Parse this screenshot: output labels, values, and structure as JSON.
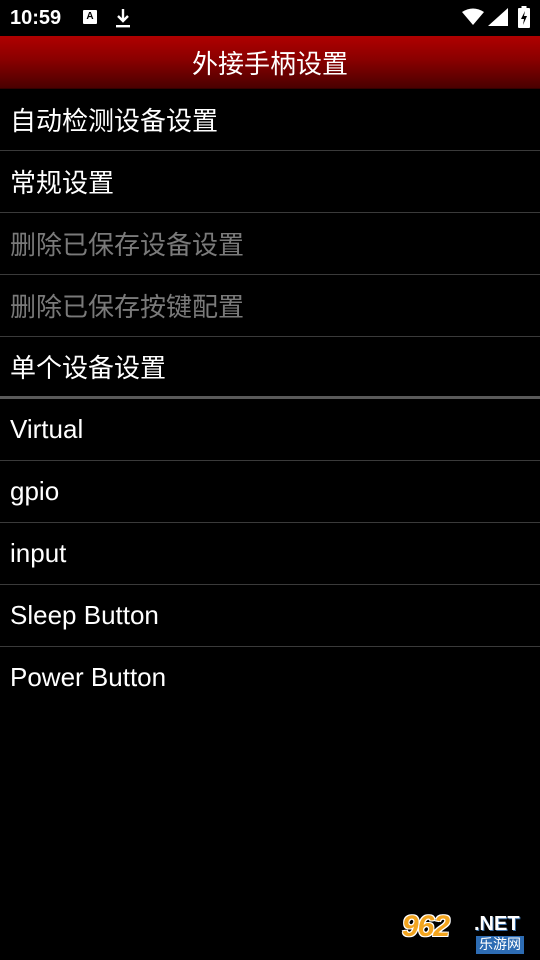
{
  "status_bar": {
    "time": "10:59",
    "notification_a": "A"
  },
  "header": {
    "title": "外接手柄设置"
  },
  "menu": {
    "items": [
      {
        "label": "自动检测设备设置",
        "enabled": true
      },
      {
        "label": "常规设置",
        "enabled": true
      },
      {
        "label": "删除已保存设备设置",
        "enabled": false
      },
      {
        "label": "删除已保存按键配置",
        "enabled": false
      },
      {
        "label": "单个设备设置",
        "enabled": true
      }
    ]
  },
  "devices": {
    "items": [
      {
        "label": "Virtual"
      },
      {
        "label": "gpio"
      },
      {
        "label": "input"
      },
      {
        "label": "Sleep Button"
      },
      {
        "label": "Power Button"
      }
    ]
  },
  "watermark": {
    "number": "962",
    "suffix": ".NET",
    "subtitle": "乐游网"
  },
  "colors": {
    "title_bar_top": "#b00000",
    "title_bar_bottom": "#4a0000",
    "disabled_text": "#7a7a7a",
    "background": "#000000"
  }
}
